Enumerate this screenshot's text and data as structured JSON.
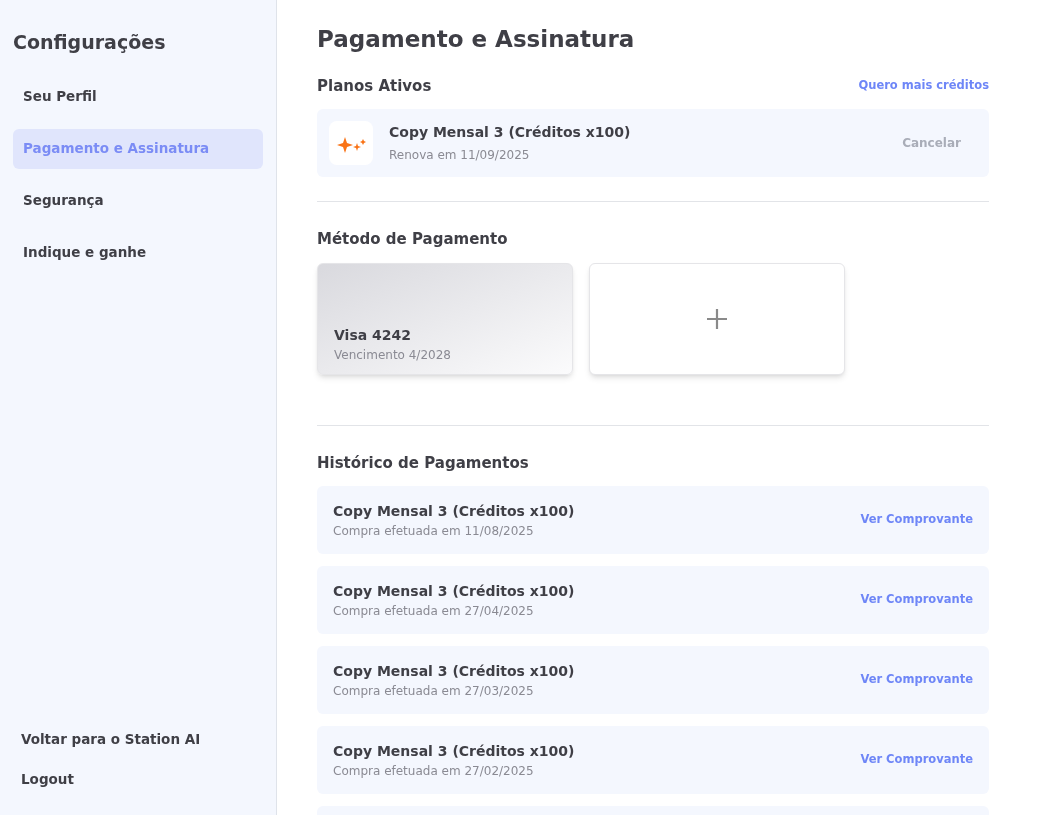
{
  "sidebar": {
    "title": "Configurações",
    "items": [
      {
        "label": "Seu Perfil",
        "selected": false
      },
      {
        "label": "Pagamento e Assinatura",
        "selected": true
      },
      {
        "label": "Segurança",
        "selected": false
      },
      {
        "label": "Indique e ganhe",
        "selected": false
      }
    ],
    "footer_links": [
      "Voltar para o Station AI",
      "Logout"
    ]
  },
  "page_title": "Pagamento e Assinatura",
  "active_plans": {
    "heading": "Planos Ativos",
    "link": "Quero mais créditos",
    "plans": [
      {
        "name": "Copy Mensal 3 (Créditos x100)",
        "renewal": "Renova em 11/09/2025",
        "cancel": {
          "label": "Cancelar",
          "disabled": true
        }
      }
    ]
  },
  "payment_method": {
    "heading": "Método de Pagamento",
    "cards": [
      {
        "name": "Visa 4242",
        "expiry": "Vencimento 4/2028"
      }
    ]
  },
  "payment_history": {
    "heading": "Histórico de Pagamentos",
    "rows": [
      {
        "name": "Copy Mensal 3 (Créditos x100)",
        "date": "Compra efetuada em 11/08/2025",
        "action": "Ver Comprovante"
      },
      {
        "name": "Copy Mensal 3 (Créditos x100)",
        "date": "Compra efetuada em 27/04/2025",
        "action": "Ver Comprovante"
      },
      {
        "name": "Copy Mensal 3 (Créditos x100)",
        "date": "Compra efetuada em 27/03/2025",
        "action": "Ver Comprovante"
      },
      {
        "name": "Copy Mensal 3 (Créditos x100)",
        "date": "Compra efetuada em 27/02/2025",
        "action": "Ver Comprovante"
      }
    ]
  }
}
